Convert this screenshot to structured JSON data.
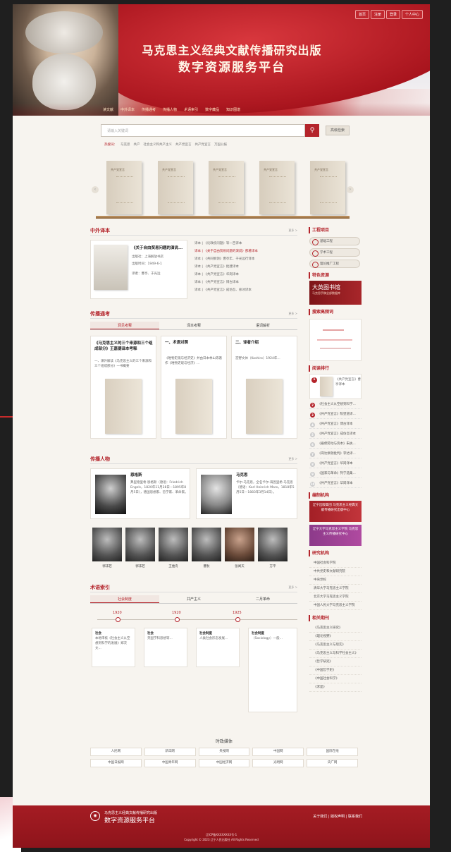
{
  "header": {
    "title_line1": "马克思主义经典文献传播研究出版",
    "title_line2": "数字资源服务平台",
    "topbar": [
      "首页",
      "注册",
      "登录",
      "个人中心"
    ]
  },
  "nav": [
    "读文献",
    "中外译本",
    "传播通考",
    "传播人物",
    "术语索引",
    "数字藏品",
    "知识图谱"
  ],
  "search": {
    "placeholder": "请输入关键词",
    "icon": "search-icon",
    "advanced_label": "高级检索",
    "hot": [
      "热搜词：",
      "马克思",
      "共产",
      "社会主义和共产主义",
      "共产党宣言",
      "共产党宣言",
      "万国公报"
    ]
  },
  "carousel": {
    "books": [
      "共产党宣言",
      "共产党宣言",
      "共产党宣言",
      "共产党宣言",
      "共产党宣言"
    ]
  },
  "translations": {
    "title": "中外译本",
    "more": "更多 >",
    "featured": {
      "title": "《关于自由贸易问题的演说...",
      "publisher": "出版社：上海解放书店",
      "date": "出版时间：1949-6-1",
      "translator": "译者：曹亭、于光远"
    },
    "list": [
      "译本 | 《论政权问题》等一百译本",
      "译本 | 《关于自由贸易问题的演说》部著译本",
      "译本 | 《共同纲领》曹亭年、于光远行译本",
      "译本 | 《共产党宣言》批建译本",
      "译本 | 《共产党宣言》华岗译本",
      "译本 | 《共产党宣言》博古译本",
      "译本 | 《共产党宣言》成仿吾、徐冰译本"
    ]
  },
  "spread": {
    "title": "传播通考",
    "more": "更多 >",
    "tabs": [
      "洞见考释",
      "译本考释",
      "语词解析"
    ],
    "cards": [
      {
        "title": "《马克思主义的三个来源和三个组成部分》王嘉德译本考释",
        "text": "一、课外解读《马克思主义的三个来源和三个组成部分》一书概要"
      },
      {
        "title": "一、术语对照",
        "text": "《唯物史观与经济史》并由日本林山等著作《唯物史观与经济》..."
      },
      {
        "title": "二、译者介绍",
        "text": "宫野文体（Koshiro）1924年..."
      }
    ]
  },
  "people": {
    "title": "传播人物",
    "more": "更多 >",
    "main": [
      {
        "name": "恩格斯",
        "text": "弗里德里希·恩格斯（德语：Friedrich Engels，1820年11月28日－1895年8月5日），德国思想家、哲学家、革命家。"
      },
      {
        "name": "马克思",
        "text": "卡尔·马克思，全名卡尔·海因里希·马克思（德语：Karl Heinrich Marx，1818年5月5日－1883年3月14日）。"
      }
    ],
    "row": [
      "郭沫若",
      "郭沫若",
      "王维舟",
      "瞿秋",
      "张闻天",
      "方平"
    ]
  },
  "terms": {
    "title": "术语索引",
    "more": "更多 >",
    "tabs": [
      "社会制度",
      "共产主义",
      "二月革命"
    ],
    "years": [
      "1920",
      "1920",
      "1925"
    ],
    "cards": [
      {
        "title": "社会",
        "text": "本地审核《社会主义从空想到科学的发展》郑次文..."
      },
      {
        "title": "社会",
        "text": "英国学科思想等..."
      },
      {
        "title": "社会制度",
        "text": "人类社会形态发展..."
      },
      {
        "title": "社会制度",
        "text": "（Sociology）一般..."
      }
    ]
  },
  "sidebar": {
    "projects_title": "工程项目",
    "projects": [
      "基础工程",
      "学术工程",
      "理论推广工程"
    ],
    "special_title": "特色资源",
    "special_banner": "大英图书馆",
    "special_sub": "马克思手稿全部数据库",
    "search_title": "搜索高频词",
    "rank_title": "阅读排行",
    "rank": [
      "《共产党宣言》曹亭译本",
      "《社会主义从空想到科学...",
      "《共产党宣言》陈望道译...",
      "《共产党宣言》博古译本",
      "《共产党宣言》成仿吾译本",
      "《雇佣劳动与资本》朱执...",
      "《哥达纲领批判》李达译...",
      "《共产党宣言》华岗译本",
      "《国家与革命》列宁选集...",
      "《共产党宣言》华岗译本"
    ],
    "org_title": "编制机构",
    "org_banner": "辽宁出版集团 马克思主义经典文献传播研究出版中心",
    "org_banner2": "辽宁大学马克思主义学院 马克思主义传播研究中心",
    "research_title": "研究机构",
    "research": [
      "中国社会科学院",
      "中共党史和文献研究院",
      "中央党校",
      "清华大学马克思主义学院",
      "北京大学马克思主义学院",
      "中国人民大学马克思主义学院"
    ],
    "journals_title": "相关期刊",
    "journals": [
      "《马克思主义研究》",
      "《理论视野》",
      "《马克思主义与现实》",
      "《马克思主义与科学社会主义》",
      "《哲学研究》",
      "《中国哲学史》",
      "《中国社会科学》",
      "《求是》"
    ]
  },
  "media": {
    "title": "时政媒体",
    "items": [
      "人民网",
      "新华网",
      "央视网",
      "中国网",
      "国际在线",
      "中国日报网",
      "中国青年网",
      "中国经济网",
      "光明网",
      "央广网"
    ]
  },
  "footer": {
    "org": "马克思主义经典文献传播研究出版",
    "platform": "数字资源服务平台",
    "links": "关于我们 | 版权声明 | 联系我们",
    "icp": "辽ICP备XXXXXXXX号-1",
    "copyright": "Copyright © 2023 辽宁人民出版社 All Rights Reserved"
  },
  "colors": {
    "accent": "#b4242b",
    "background": "#f7f4ef"
  }
}
